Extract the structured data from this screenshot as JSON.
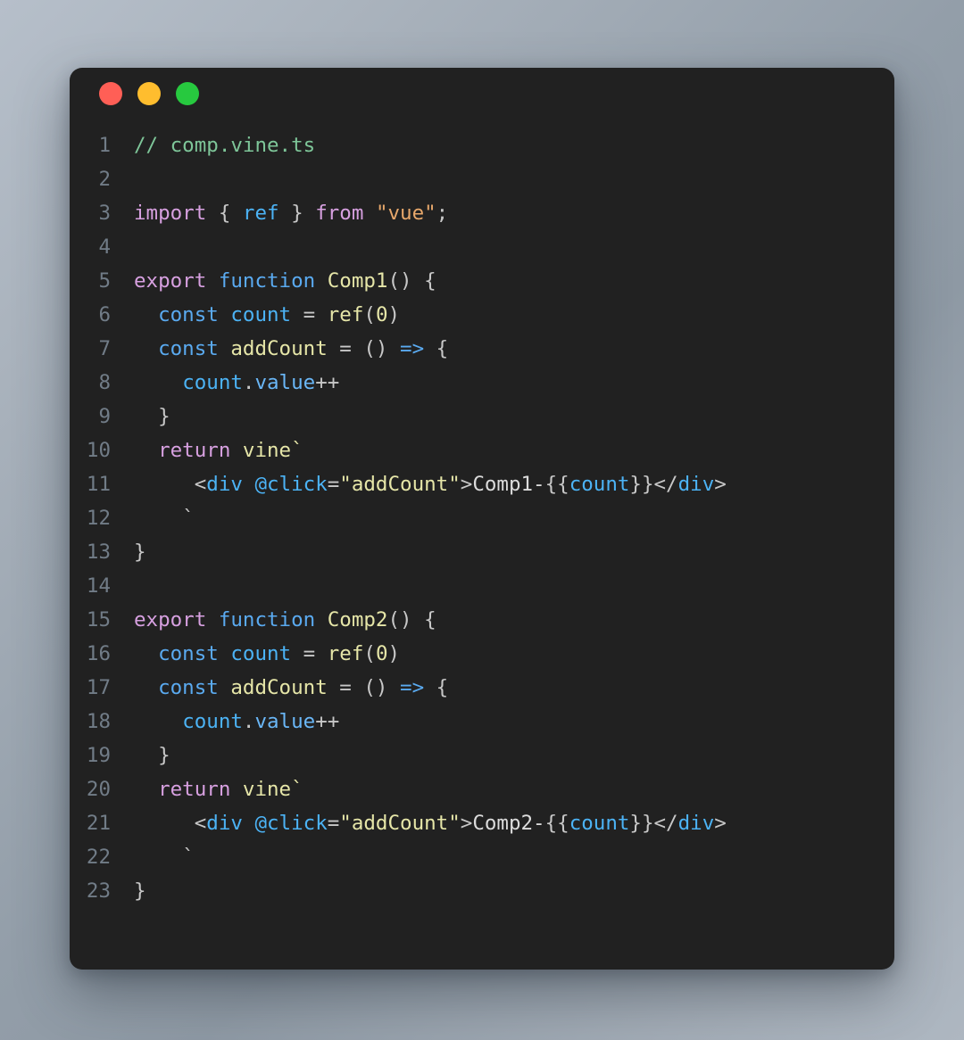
{
  "window": {
    "controls": [
      {
        "name": "close",
        "color": "#ff5f56"
      },
      {
        "name": "minimize",
        "color": "#ffbd2e"
      },
      {
        "name": "maximize",
        "color": "#27c93f"
      }
    ]
  },
  "editor": {
    "language": "typescript",
    "filename": "comp.vine.ts",
    "background": "#212121",
    "line_number_color": "#717c87",
    "total_lines": 23,
    "palette": {
      "comment": "#7ec699",
      "keyword": "#d7a0e0",
      "declaration": "#5aaaf0",
      "function_name": "#e6e6a8",
      "variable": "#4cb3f5",
      "property": "#6ab7f7",
      "string": "#e8a86b",
      "attribute_string": "#e6e6a8",
      "punctuation": "#c8c8c8",
      "tag": "#4cb3f5",
      "text": "#dcdcdc"
    },
    "lines": [
      {
        "n": "1",
        "tokens": [
          {
            "t": "// comp.vine.ts",
            "c": "t-comment"
          }
        ]
      },
      {
        "n": "2",
        "tokens": []
      },
      {
        "n": "3",
        "tokens": [
          {
            "t": "import",
            "c": "t-key"
          },
          {
            "t": " ",
            "c": "t-plain"
          },
          {
            "t": "{",
            "c": "t-punct"
          },
          {
            "t": " ",
            "c": "t-plain"
          },
          {
            "t": "ref",
            "c": "t-var"
          },
          {
            "t": " ",
            "c": "t-plain"
          },
          {
            "t": "}",
            "c": "t-punct"
          },
          {
            "t": " ",
            "c": "t-plain"
          },
          {
            "t": "from",
            "c": "t-key"
          },
          {
            "t": " ",
            "c": "t-plain"
          },
          {
            "t": "\"vue\"",
            "c": "t-str"
          },
          {
            "t": ";",
            "c": "t-punct"
          }
        ]
      },
      {
        "n": "4",
        "tokens": []
      },
      {
        "n": "5",
        "tokens": [
          {
            "t": "export",
            "c": "t-key"
          },
          {
            "t": " ",
            "c": "t-plain"
          },
          {
            "t": "function",
            "c": "t-fnkw"
          },
          {
            "t": " ",
            "c": "t-plain"
          },
          {
            "t": "Comp1",
            "c": "t-fnname"
          },
          {
            "t": "()",
            "c": "t-punct"
          },
          {
            "t": " ",
            "c": "t-plain"
          },
          {
            "t": "{",
            "c": "t-punct"
          }
        ]
      },
      {
        "n": "6",
        "tokens": [
          {
            "t": "  ",
            "c": "t-plain"
          },
          {
            "t": "const",
            "c": "t-fnkw"
          },
          {
            "t": " ",
            "c": "t-plain"
          },
          {
            "t": "count",
            "c": "t-var"
          },
          {
            "t": " ",
            "c": "t-plain"
          },
          {
            "t": "=",
            "c": "t-punct"
          },
          {
            "t": " ",
            "c": "t-plain"
          },
          {
            "t": "ref",
            "c": "t-fnname"
          },
          {
            "t": "(",
            "c": "t-punct"
          },
          {
            "t": "0",
            "c": "t-fnname"
          },
          {
            "t": ")",
            "c": "t-punct"
          }
        ]
      },
      {
        "n": "7",
        "tokens": [
          {
            "t": "  ",
            "c": "t-plain"
          },
          {
            "t": "const",
            "c": "t-fnkw"
          },
          {
            "t": " ",
            "c": "t-plain"
          },
          {
            "t": "addCount",
            "c": "t-fnname"
          },
          {
            "t": " ",
            "c": "t-plain"
          },
          {
            "t": "=",
            "c": "t-punct"
          },
          {
            "t": " ",
            "c": "t-plain"
          },
          {
            "t": "()",
            "c": "t-punct"
          },
          {
            "t": " ",
            "c": "t-plain"
          },
          {
            "t": "=>",
            "c": "t-fnkw"
          },
          {
            "t": " ",
            "c": "t-plain"
          },
          {
            "t": "{",
            "c": "t-punct"
          }
        ]
      },
      {
        "n": "8",
        "tokens": [
          {
            "t": "    ",
            "c": "t-plain"
          },
          {
            "t": "count",
            "c": "t-var"
          },
          {
            "t": ".",
            "c": "t-punct"
          },
          {
            "t": "value",
            "c": "t-prop"
          },
          {
            "t": "++",
            "c": "t-punct"
          }
        ]
      },
      {
        "n": "9",
        "tokens": [
          {
            "t": "  ",
            "c": "t-plain"
          },
          {
            "t": "}",
            "c": "t-punct"
          }
        ]
      },
      {
        "n": "10",
        "tokens": [
          {
            "t": "  ",
            "c": "t-plain"
          },
          {
            "t": "return",
            "c": "t-key"
          },
          {
            "t": " ",
            "c": "t-plain"
          },
          {
            "t": "vine`",
            "c": "t-fnname"
          }
        ]
      },
      {
        "n": "11",
        "tokens": [
          {
            "t": "     ",
            "c": "t-plain"
          },
          {
            "t": "<",
            "c": "t-punct"
          },
          {
            "t": "div",
            "c": "t-tag"
          },
          {
            "t": " ",
            "c": "t-plain"
          },
          {
            "t": "@click",
            "c": "t-tag"
          },
          {
            "t": "=",
            "c": "t-punct"
          },
          {
            "t": "\"addCount\"",
            "c": "t-attrstr"
          },
          {
            "t": ">",
            "c": "t-punct"
          },
          {
            "t": "Comp1-",
            "c": "t-text"
          },
          {
            "t": "{{",
            "c": "t-punct"
          },
          {
            "t": "count",
            "c": "t-tag"
          },
          {
            "t": "}}",
            "c": "t-punct"
          },
          {
            "t": "</",
            "c": "t-punct"
          },
          {
            "t": "div",
            "c": "t-tag"
          },
          {
            "t": ">",
            "c": "t-punct"
          }
        ]
      },
      {
        "n": "12",
        "tokens": [
          {
            "t": "    ",
            "c": "t-plain"
          },
          {
            "t": "`",
            "c": "t-punct"
          }
        ]
      },
      {
        "n": "13",
        "tokens": [
          {
            "t": "}",
            "c": "t-punct"
          }
        ]
      },
      {
        "n": "14",
        "tokens": []
      },
      {
        "n": "15",
        "tokens": [
          {
            "t": "export",
            "c": "t-key"
          },
          {
            "t": " ",
            "c": "t-plain"
          },
          {
            "t": "function",
            "c": "t-fnkw"
          },
          {
            "t": " ",
            "c": "t-plain"
          },
          {
            "t": "Comp2",
            "c": "t-fnname"
          },
          {
            "t": "()",
            "c": "t-punct"
          },
          {
            "t": " ",
            "c": "t-plain"
          },
          {
            "t": "{",
            "c": "t-punct"
          }
        ]
      },
      {
        "n": "16",
        "tokens": [
          {
            "t": "  ",
            "c": "t-plain"
          },
          {
            "t": "const",
            "c": "t-fnkw"
          },
          {
            "t": " ",
            "c": "t-plain"
          },
          {
            "t": "count",
            "c": "t-var"
          },
          {
            "t": " ",
            "c": "t-plain"
          },
          {
            "t": "=",
            "c": "t-punct"
          },
          {
            "t": " ",
            "c": "t-plain"
          },
          {
            "t": "ref",
            "c": "t-fnname"
          },
          {
            "t": "(",
            "c": "t-punct"
          },
          {
            "t": "0",
            "c": "t-fnname"
          },
          {
            "t": ")",
            "c": "t-punct"
          }
        ]
      },
      {
        "n": "17",
        "tokens": [
          {
            "t": "  ",
            "c": "t-plain"
          },
          {
            "t": "const",
            "c": "t-fnkw"
          },
          {
            "t": " ",
            "c": "t-plain"
          },
          {
            "t": "addCount",
            "c": "t-fnname"
          },
          {
            "t": " ",
            "c": "t-plain"
          },
          {
            "t": "=",
            "c": "t-punct"
          },
          {
            "t": " ",
            "c": "t-plain"
          },
          {
            "t": "()",
            "c": "t-punct"
          },
          {
            "t": " ",
            "c": "t-plain"
          },
          {
            "t": "=>",
            "c": "t-fnkw"
          },
          {
            "t": " ",
            "c": "t-plain"
          },
          {
            "t": "{",
            "c": "t-punct"
          }
        ]
      },
      {
        "n": "18",
        "tokens": [
          {
            "t": "    ",
            "c": "t-plain"
          },
          {
            "t": "count",
            "c": "t-var"
          },
          {
            "t": ".",
            "c": "t-punct"
          },
          {
            "t": "value",
            "c": "t-prop"
          },
          {
            "t": "++",
            "c": "t-punct"
          }
        ]
      },
      {
        "n": "19",
        "tokens": [
          {
            "t": "  ",
            "c": "t-plain"
          },
          {
            "t": "}",
            "c": "t-punct"
          }
        ]
      },
      {
        "n": "20",
        "tokens": [
          {
            "t": "  ",
            "c": "t-plain"
          },
          {
            "t": "return",
            "c": "t-key"
          },
          {
            "t": " ",
            "c": "t-plain"
          },
          {
            "t": "vine`",
            "c": "t-fnname"
          }
        ]
      },
      {
        "n": "21",
        "tokens": [
          {
            "t": "     ",
            "c": "t-plain"
          },
          {
            "t": "<",
            "c": "t-punct"
          },
          {
            "t": "div",
            "c": "t-tag"
          },
          {
            "t": " ",
            "c": "t-plain"
          },
          {
            "t": "@click",
            "c": "t-tag"
          },
          {
            "t": "=",
            "c": "t-punct"
          },
          {
            "t": "\"addCount\"",
            "c": "t-attrstr"
          },
          {
            "t": ">",
            "c": "t-punct"
          },
          {
            "t": "Comp2-",
            "c": "t-text"
          },
          {
            "t": "{{",
            "c": "t-punct"
          },
          {
            "t": "count",
            "c": "t-tag"
          },
          {
            "t": "}}",
            "c": "t-punct"
          },
          {
            "t": "</",
            "c": "t-punct"
          },
          {
            "t": "div",
            "c": "t-tag"
          },
          {
            "t": ">",
            "c": "t-punct"
          }
        ]
      },
      {
        "n": "22",
        "tokens": [
          {
            "t": "    ",
            "c": "t-plain"
          },
          {
            "t": "`",
            "c": "t-punct"
          }
        ]
      },
      {
        "n": "23",
        "tokens": [
          {
            "t": "}",
            "c": "t-punct"
          }
        ]
      }
    ]
  }
}
